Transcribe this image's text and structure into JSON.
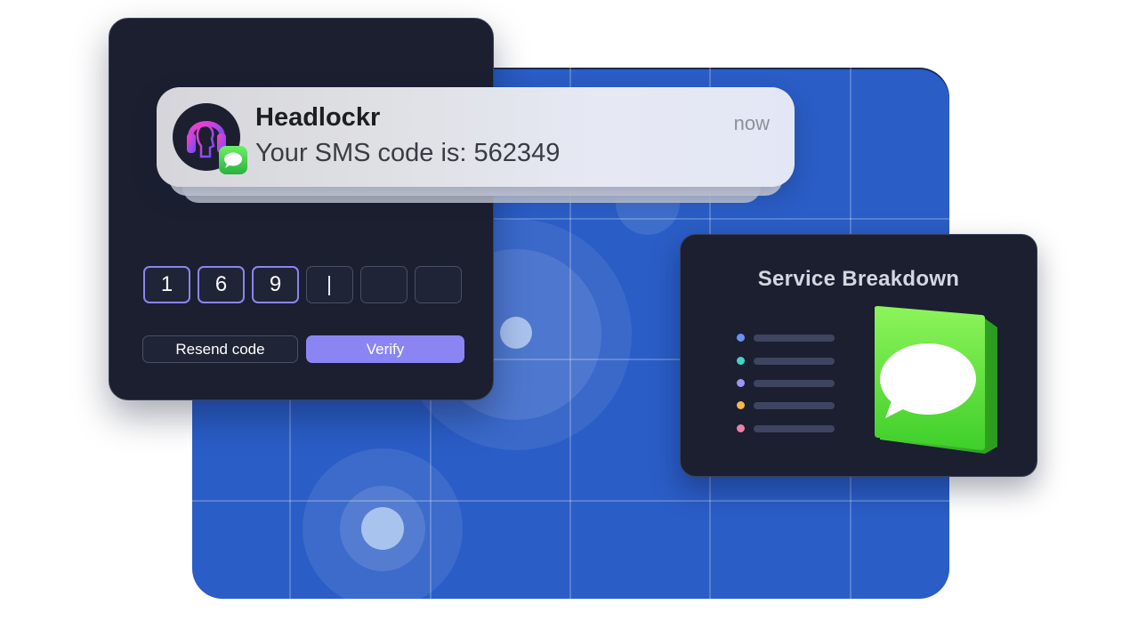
{
  "notification": {
    "app_name": "Headlockr",
    "message": "Your SMS code is: 562349",
    "time": "now",
    "app_icon": "headlockr-logo",
    "badge_icon": "messages-icon"
  },
  "verify": {
    "digits": [
      "1",
      "6",
      "9",
      "",
      "",
      ""
    ],
    "resend_label": "Resend code",
    "verify_label": "Verify"
  },
  "service": {
    "title": "Service Breakdown",
    "legend_colors": [
      "#6e8ff5",
      "#43d3c4",
      "#9f95f4",
      "#f2b94f",
      "#ef7fa5"
    ],
    "icon": "messages-app-icon"
  },
  "colors": {
    "map_blue": "#2a5dc6",
    "card_bg": "#1b1f30",
    "accent": "#8b85f3"
  }
}
